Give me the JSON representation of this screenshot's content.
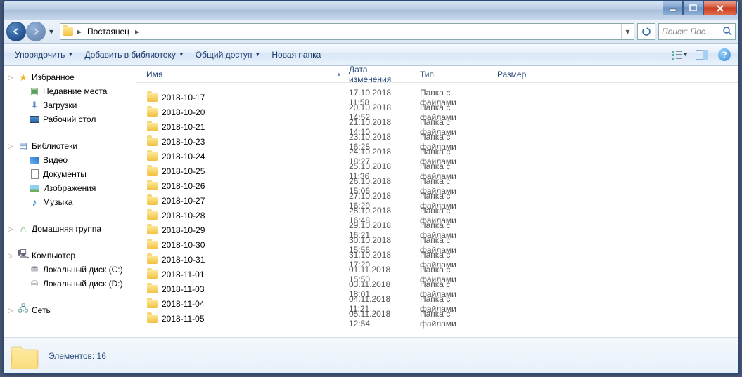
{
  "breadcrumb": {
    "root": "Постаянец"
  },
  "search": {
    "placeholder": "Поиск: Пос..."
  },
  "toolbar": {
    "organize": "Упорядочить",
    "addlib": "Добавить в библиотеку",
    "share": "Общий доступ",
    "newfolder": "Новая папка"
  },
  "columns": {
    "name": "Имя",
    "date": "Дата изменения",
    "type": "Тип",
    "size": "Размер"
  },
  "nav": {
    "favorites": "Избранное",
    "recent": "Недавние места",
    "downloads": "Загрузки",
    "desktop": "Рабочий стол",
    "libraries": "Библиотеки",
    "video": "Видео",
    "documents": "Документы",
    "images": "Изображения",
    "music": "Музыка",
    "homegroup": "Домашняя группа",
    "computer": "Компьютер",
    "diskc": "Локальный диск (C:)",
    "diskd": "Локальный диск (D:)",
    "network": "Сеть"
  },
  "files": [
    {
      "name": "2018-10-17",
      "date": "17.10.2018 11:58",
      "type": "Папка с файлами"
    },
    {
      "name": "2018-10-20",
      "date": "20.10.2018 14:52",
      "type": "Папка с файлами"
    },
    {
      "name": "2018-10-21",
      "date": "21.10.2018 14:10",
      "type": "Папка с файлами"
    },
    {
      "name": "2018-10-23",
      "date": "23.10.2018 16:28",
      "type": "Папка с файлами"
    },
    {
      "name": "2018-10-24",
      "date": "24.10.2018 18:27",
      "type": "Папка с файлами"
    },
    {
      "name": "2018-10-25",
      "date": "25.10.2018 11:36",
      "type": "Папка с файлами"
    },
    {
      "name": "2018-10-26",
      "date": "26.10.2018 15:06",
      "type": "Папка с файлами"
    },
    {
      "name": "2018-10-27",
      "date": "27.10.2018 16:29",
      "type": "Папка с файлами"
    },
    {
      "name": "2018-10-28",
      "date": "28.10.2018 16:48",
      "type": "Папка с файлами"
    },
    {
      "name": "2018-10-29",
      "date": "29.10.2018 16:21",
      "type": "Папка с файлами"
    },
    {
      "name": "2018-10-30",
      "date": "30.10.2018 15:56",
      "type": "Папка с файлами"
    },
    {
      "name": "2018-10-31",
      "date": "31.10.2018 17:20",
      "type": "Папка с файлами"
    },
    {
      "name": "2018-11-01",
      "date": "01.11.2018 15:50",
      "type": "Папка с файлами"
    },
    {
      "name": "2018-11-03",
      "date": "03.11.2018 18:01",
      "type": "Папка с файлами"
    },
    {
      "name": "2018-11-04",
      "date": "04.11.2018 11:21",
      "type": "Папка с файлами"
    },
    {
      "name": "2018-11-05",
      "date": "05.11.2018 12:54",
      "type": "Папка с файлами"
    }
  ],
  "details": {
    "count": "Элементов: 16"
  }
}
